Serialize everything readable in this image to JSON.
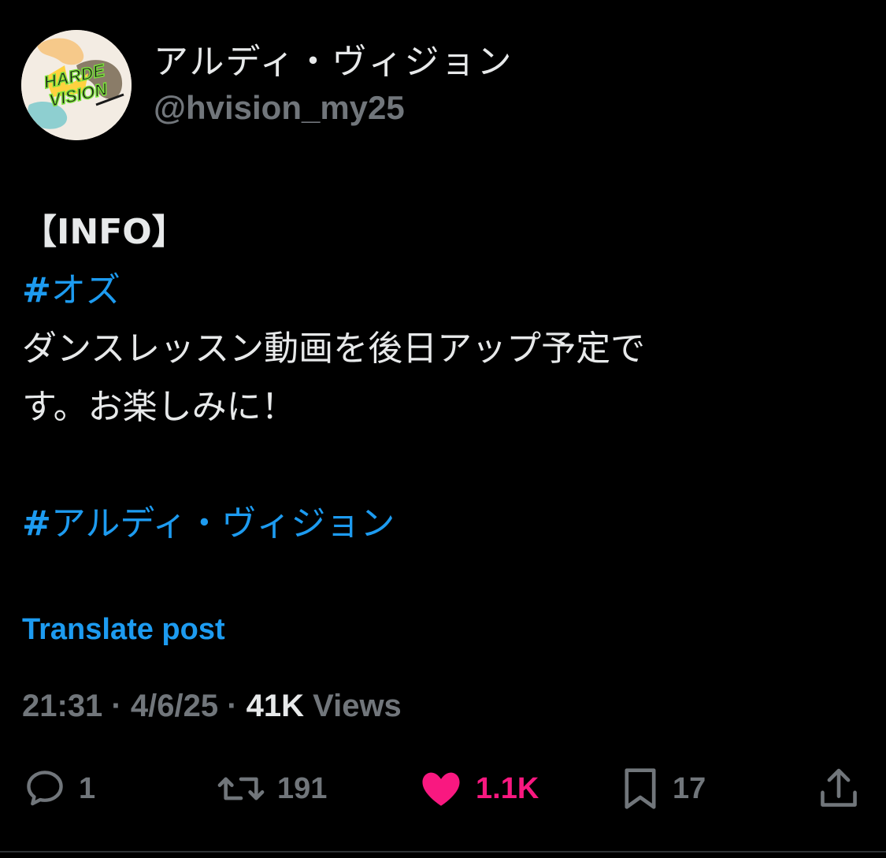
{
  "author": {
    "display_name": "アルディ・ヴィジョン",
    "handle": "@hvision_my25",
    "avatar_text_line1": "HARDE",
    "avatar_text_line2": "VISION"
  },
  "post": {
    "line1": "【INFO】",
    "hashtag1_symbol": "#",
    "hashtag1_text": "オズ",
    "line3": "ダンスレッスン動画を後日アップ予定で",
    "line4": "す。お楽しみに！",
    "hashtag2_symbol": "#",
    "hashtag2_text": "アルディ・ヴィジョン"
  },
  "translate_label": "Translate post",
  "meta": {
    "time": "21:31",
    "separator": " · ",
    "date": "4/6/25",
    "views_count": "41K",
    "views_label": " Views"
  },
  "actions": {
    "replies": "1",
    "reposts": "191",
    "likes": "1.1K",
    "bookmarks": "17"
  },
  "colors": {
    "background": "#000000",
    "text": "#e7e9ea",
    "secondary": "#71767b",
    "link": "#1d9bf0",
    "like": "#f91880"
  },
  "icons": {
    "reply": "reply-icon",
    "repost": "repost-icon",
    "like": "heart-icon",
    "bookmark": "bookmark-icon",
    "share": "share-icon"
  }
}
